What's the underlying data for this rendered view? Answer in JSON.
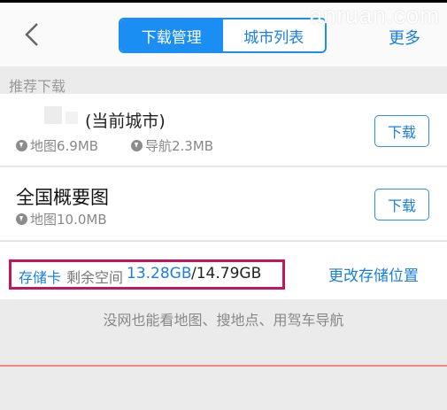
{
  "watermark": "anruan.com",
  "header": {
    "back_icon": "chevron-left-icon",
    "tabs": [
      {
        "label": "下载管理",
        "active": true
      },
      {
        "label": "城市列表",
        "active": false
      }
    ],
    "more_label": "更多"
  },
  "section": {
    "title": "推荐下载"
  },
  "downloads": [
    {
      "name": "(当前城市)",
      "map_size": "地图6.9MB",
      "nav_size": "导航2.3MB",
      "button": "下载"
    },
    {
      "name": "全国概要图",
      "map_size": "地图10.0MB",
      "button": "下载"
    }
  ],
  "storage": {
    "label": "存储卡",
    "remaining_label": "剩余空间",
    "free": "13.28GB",
    "total": "/14.79GB",
    "change_location": "更改存储位置"
  },
  "tip": "没网也能看地图、搜地点、用驾车导航",
  "colors": {
    "accent": "#1b8ef4",
    "highlight_border": "#c2185b",
    "divider": "#ef8a80"
  }
}
